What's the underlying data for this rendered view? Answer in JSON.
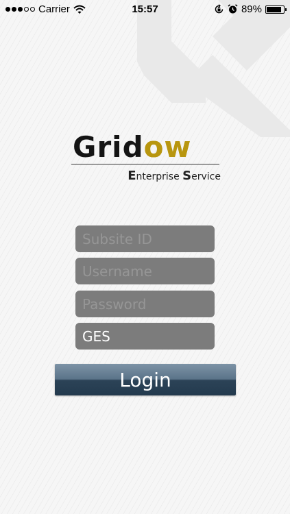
{
  "status_bar": {
    "carrier": "Carrier",
    "time": "15:57",
    "battery_percent": "89%",
    "battery_level": 0.89,
    "signal_bars_filled": 3,
    "signal_bars_total": 5,
    "icons": [
      "wifi-icon",
      "orientation-lock-icon",
      "alarm-icon",
      "battery-icon"
    ]
  },
  "logo": {
    "word_main": "Grid",
    "word_accent": "ow",
    "tagline_cap1": "E",
    "tagline_rest1": "nterprise ",
    "tagline_cap2": "S",
    "tagline_rest2": "ervice",
    "accent_color": "#b8960f"
  },
  "form": {
    "subsite_placeholder": "Subsite ID",
    "username_placeholder": "Username",
    "password_placeholder": "Password",
    "ges_value": "GES"
  },
  "login_button": {
    "label": "Login"
  },
  "colors": {
    "field_background": "#7c7c7c",
    "placeholder": "#969696",
    "button_top": "#7d93a6",
    "button_bottom": "#233a4e"
  }
}
